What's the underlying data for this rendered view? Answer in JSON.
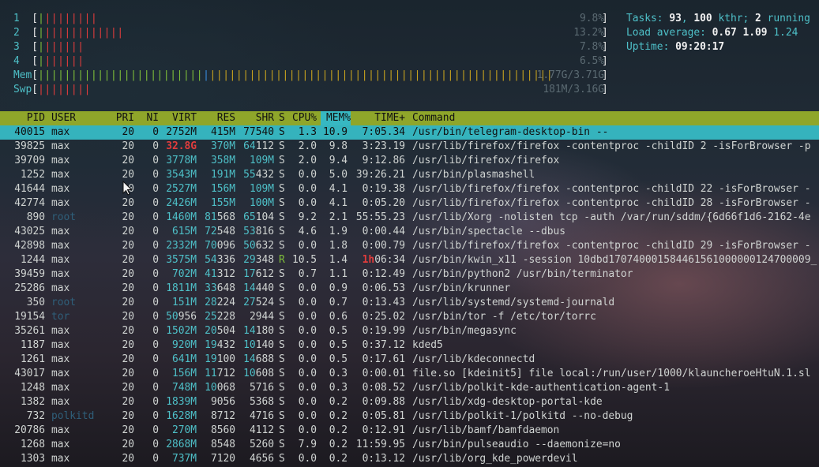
{
  "meters": [
    {
      "label": "1",
      "green": "|",
      "red": "||||||||",
      "yellow": "",
      "blue": "",
      "value": "9.8%"
    },
    {
      "label": "2",
      "green": "|",
      "red": "||||||||||||",
      "yellow": "",
      "blue": "",
      "value": "13.2%"
    },
    {
      "label": "3",
      "green": "|",
      "red": "||||||",
      "yellow": "",
      "blue": "",
      "value": "7.8%"
    },
    {
      "label": "4",
      "green": "|",
      "red": "||||||",
      "yellow": "",
      "blue": "",
      "value": "6.5%"
    },
    {
      "label": "Mem",
      "green": "|||||||||||||||||||||||||",
      "red": "",
      "yellow": "||||||||||||||||||||||||||||||||||||||||||||||||||||",
      "blue": "|",
      "value": "1.77G/3.71G"
    },
    {
      "label": "Swp",
      "green": "",
      "red": "||||||||",
      "yellow": "",
      "blue": "",
      "value": "181M/3.16G"
    }
  ],
  "stats": {
    "tasks_label": "Tasks:",
    "tasks": "93",
    "threads": "100",
    "kthr": "kthr;",
    "running": "2",
    "running_label": "running",
    "load_label": "Load average:",
    "load1": "0.67",
    "load5": "1.09",
    "load15": "1.24",
    "uptime_label": "Uptime:",
    "uptime": "09:20:17"
  },
  "columns": [
    "PID",
    "USER",
    "PRI",
    "NI",
    "VIRT",
    "RES",
    "SHR",
    "S",
    "CPU%",
    "MEM%",
    "TIME+",
    "Command"
  ],
  "processes": [
    {
      "pid": "40015",
      "user": "max",
      "pri": "20",
      "ni": "0",
      "virt": "2752M",
      "res": "415M",
      "shr": "77540",
      "s": "S",
      "cpu": "1.3",
      "mem": "10.9",
      "time": "7:05.34",
      "cmd": "/usr/bin/telegram-desktop-bin --",
      "selected": true
    },
    {
      "pid": "39825",
      "user": "max",
      "pri": "20",
      "ni": "0",
      "virt": "32.8G",
      "res": "370M",
      "shr": "64112",
      "s": "S",
      "cpu": "2.0",
      "mem": "9.8",
      "time": "3:23.19",
      "cmd": "/usr/lib/firefox/firefox -contentproc -childID 2 -isForBrowser -p"
    },
    {
      "pid": "39709",
      "user": "max",
      "pri": "20",
      "ni": "0",
      "virt": "3778M",
      "res": "358M",
      "shr": "109M",
      "s": "S",
      "cpu": "2.0",
      "mem": "9.4",
      "time": "9:12.86",
      "cmd": "/usr/lib/firefox/firefox"
    },
    {
      "pid": "1252",
      "user": "max",
      "pri": "20",
      "ni": "0",
      "virt": "3543M",
      "res": "191M",
      "shr": "55432",
      "s": "S",
      "cpu": "0.0",
      "mem": "5.0",
      "time": "39:26.21",
      "cmd": "/usr/bin/plasmashell"
    },
    {
      "pid": "41644",
      "user": "max",
      "pri": "20",
      "ni": "0",
      "virt": "2527M",
      "res": "156M",
      "shr": "109M",
      "s": "S",
      "cpu": "0.0",
      "mem": "4.1",
      "time": "0:19.38",
      "cmd": "/usr/lib/firefox/firefox -contentproc -childID 22 -isForBrowser -"
    },
    {
      "pid": "42774",
      "user": "max",
      "pri": "20",
      "ni": "0",
      "virt": "2426M",
      "res": "155M",
      "shr": "100M",
      "s": "S",
      "cpu": "0.0",
      "mem": "4.1",
      "time": "0:05.20",
      "cmd": "/usr/lib/firefox/firefox -contentproc -childID 28 -isForBrowser -"
    },
    {
      "pid": "890",
      "user": "root",
      "pri": "20",
      "ni": "0",
      "virt": "1460M",
      "res": "81568",
      "shr": "65104",
      "s": "S",
      "cpu": "9.2",
      "mem": "2.1",
      "time": "55:55.23",
      "cmd": "/usr/lib/Xorg -nolisten tcp -auth /var/run/sddm/{6d66f1d6-2162-4e"
    },
    {
      "pid": "43025",
      "user": "max",
      "pri": "20",
      "ni": "0",
      "virt": "615M",
      "res": "72548",
      "shr": "53816",
      "s": "S",
      "cpu": "4.6",
      "mem": "1.9",
      "time": "0:00.44",
      "cmd": "/usr/bin/spectacle --dbus"
    },
    {
      "pid": "42898",
      "user": "max",
      "pri": "20",
      "ni": "0",
      "virt": "2332M",
      "res": "70096",
      "shr": "50632",
      "s": "S",
      "cpu": "0.0",
      "mem": "1.8",
      "time": "0:00.79",
      "cmd": "/usr/lib/firefox/firefox -contentproc -childID 29 -isForBrowser -"
    },
    {
      "pid": "1244",
      "user": "max",
      "pri": "20",
      "ni": "0",
      "virt": "3575M",
      "res": "54336",
      "shr": "29348",
      "s": "R",
      "cpu": "10.5",
      "mem": "1.4",
      "time_h": "1h",
      "time": "06:34",
      "cmd": "/usr/bin/kwin_x11 -session 10dbd170740001584461561000000124700009_"
    },
    {
      "pid": "39459",
      "user": "max",
      "pri": "20",
      "ni": "0",
      "virt": "702M",
      "res": "41312",
      "shr": "17612",
      "s": "S",
      "cpu": "0.7",
      "mem": "1.1",
      "time": "0:12.49",
      "cmd": "/usr/bin/python2 /usr/bin/terminator"
    },
    {
      "pid": "25286",
      "user": "max",
      "pri": "20",
      "ni": "0",
      "virt": "1811M",
      "res": "33648",
      "shr": "14440",
      "s": "S",
      "cpu": "0.0",
      "mem": "0.9",
      "time": "0:06.53",
      "cmd": "/usr/bin/krunner"
    },
    {
      "pid": "350",
      "user": "root",
      "pri": "20",
      "ni": "0",
      "virt": "151M",
      "res": "28224",
      "shr": "27524",
      "s": "S",
      "cpu": "0.0",
      "mem": "0.7",
      "time": "0:13.43",
      "cmd": "/usr/lib/systemd/systemd-journald"
    },
    {
      "pid": "19154",
      "user": "tor",
      "pri": "20",
      "ni": "0",
      "virt": "50956",
      "res": "25228",
      "shr": "2944",
      "s": "S",
      "cpu": "0.0",
      "mem": "0.6",
      "time": "0:25.02",
      "cmd": "/usr/bin/tor -f /etc/tor/torrc"
    },
    {
      "pid": "35261",
      "user": "max",
      "pri": "20",
      "ni": "0",
      "virt": "1502M",
      "res": "20504",
      "shr": "14180",
      "s": "S",
      "cpu": "0.0",
      "mem": "0.5",
      "time": "0:19.99",
      "cmd": "/usr/bin/megasync"
    },
    {
      "pid": "1187",
      "user": "max",
      "pri": "20",
      "ni": "0",
      "virt": "920M",
      "res": "19432",
      "shr": "10140",
      "s": "S",
      "cpu": "0.0",
      "mem": "0.5",
      "time": "0:37.12",
      "cmd": "kded5"
    },
    {
      "pid": "1261",
      "user": "max",
      "pri": "20",
      "ni": "0",
      "virt": "641M",
      "res": "19100",
      "shr": "14688",
      "s": "S",
      "cpu": "0.0",
      "mem": "0.5",
      "time": "0:17.61",
      "cmd": "/usr/lib/kdeconnectd"
    },
    {
      "pid": "43017",
      "user": "max",
      "pri": "20",
      "ni": "0",
      "virt": "156M",
      "res": "11712",
      "shr": "10608",
      "s": "S",
      "cpu": "0.0",
      "mem": "0.3",
      "time": "0:00.01",
      "cmd": "file.so [kdeinit5] file local:/run/user/1000/klauncheroeHtuN.1.sl"
    },
    {
      "pid": "1248",
      "user": "max",
      "pri": "20",
      "ni": "0",
      "virt": "748M",
      "res": "10068",
      "shr": "5716",
      "s": "S",
      "cpu": "0.0",
      "mem": "0.3",
      "time": "0:08.52",
      "cmd": "/usr/lib/polkit-kde-authentication-agent-1"
    },
    {
      "pid": "1382",
      "user": "max",
      "pri": "20",
      "ni": "0",
      "virt": "1839M",
      "res": "9056",
      "shr": "5368",
      "s": "S",
      "cpu": "0.0",
      "mem": "0.2",
      "time": "0:09.88",
      "cmd": "/usr/lib/xdg-desktop-portal-kde"
    },
    {
      "pid": "732",
      "user": "polkitd",
      "pri": "20",
      "ni": "0",
      "virt": "1628M",
      "res": "8712",
      "shr": "4716",
      "s": "S",
      "cpu": "0.0",
      "mem": "0.2",
      "time": "0:05.81",
      "cmd": "/usr/lib/polkit-1/polkitd --no-debug"
    },
    {
      "pid": "20786",
      "user": "max",
      "pri": "20",
      "ni": "0",
      "virt": "270M",
      "res": "8560",
      "shr": "4112",
      "s": "S",
      "cpu": "0.0",
      "mem": "0.2",
      "time": "0:12.91",
      "cmd": "/usr/lib/bamf/bamfdaemon"
    },
    {
      "pid": "1268",
      "user": "max",
      "pri": "20",
      "ni": "0",
      "virt": "2868M",
      "res": "8548",
      "shr": "5260",
      "s": "S",
      "cpu": "7.9",
      "mem": "0.2",
      "time": "11:59.95",
      "cmd": "/usr/bin/pulseaudio --daemonize=no"
    },
    {
      "pid": "1303",
      "user": "max",
      "pri": "20",
      "ni": "0",
      "virt": "737M",
      "res": "7120",
      "shr": "4656",
      "s": "S",
      "cpu": "0.0",
      "mem": "0.2",
      "time": "0:13.12",
      "cmd": "/usr/lib/org_kde_powerdevil"
    }
  ]
}
